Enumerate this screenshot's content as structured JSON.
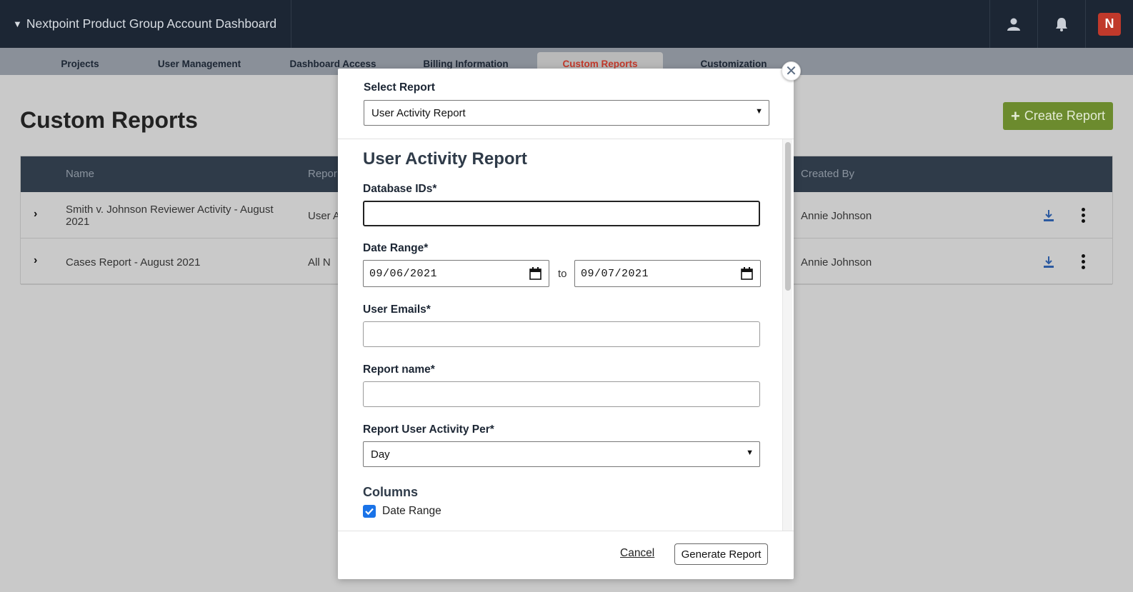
{
  "header": {
    "title": "Nextpoint Product Group Account Dashboard",
    "caret": "▼",
    "brand_glyph": "N",
    "icons": [
      "user-icon",
      "bell-icon",
      "brand-logo-icon"
    ]
  },
  "tabs": [
    {
      "label": "Projects"
    },
    {
      "label": "User Management"
    },
    {
      "label": "Dashboard Access"
    },
    {
      "label": "Billing Information"
    },
    {
      "label": "Custom Reports",
      "active": true
    },
    {
      "label": "Customization"
    }
  ],
  "page": {
    "title": "Custom Reports",
    "create_button": "Create Report",
    "create_button_icon": "+"
  },
  "table": {
    "columns": [
      "Name",
      "Repor",
      "Created By"
    ],
    "rows": [
      {
        "name": "Smith v. Johnson Reviewer Activity - August 2021",
        "report": "User A",
        "created_by": "Annie Johnson"
      },
      {
        "name": "Cases Report - August 2021",
        "report": "All N",
        "created_by": "Annie Johnson"
      }
    ],
    "chevron": "›"
  },
  "modal": {
    "close_glyph": "✕",
    "select_report_label": "Select Report",
    "selected_report": "User Activity Report",
    "section_title": "User Activity Report",
    "database_ids_label": "Database IDs*",
    "date_range_label": "Date Range*",
    "date_from": "09/06/2021",
    "date_to_word": "to",
    "date_to": "09/07/2021",
    "user_emails_label": "User Emails*",
    "report_name_label": "Report name*",
    "activity_per_label": "Report User Activity Per*",
    "activity_per_value": "Day",
    "columns_title": "Columns",
    "columns": [
      {
        "label": "Date Range",
        "checked": true
      }
    ],
    "cancel": "Cancel",
    "generate": "Generate Report"
  },
  "colors": {
    "header_bg": "#1c2634",
    "active_tab": "#c0392b",
    "create_button": "#6c8b2e",
    "checkbox": "#1a73e8"
  }
}
